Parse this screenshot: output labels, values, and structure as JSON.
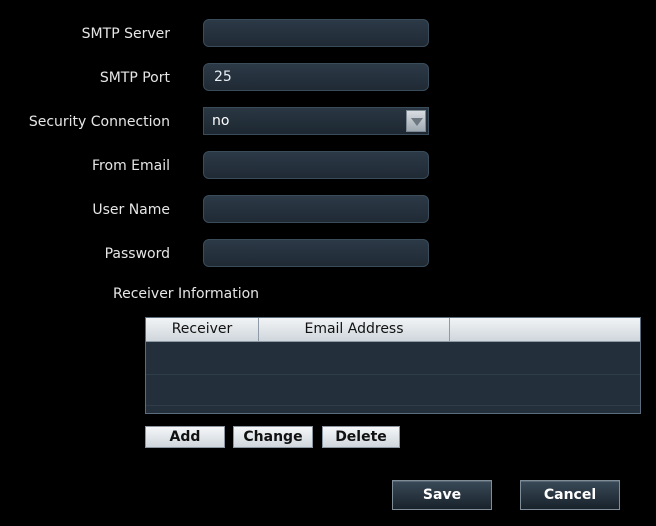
{
  "form": {
    "smtp_server": {
      "label": "SMTP Server",
      "value": ""
    },
    "smtp_port": {
      "label": "SMTP Port",
      "value": "25"
    },
    "security_connection": {
      "label": "Security Connection",
      "value": "no"
    },
    "from_email": {
      "label": "From Email",
      "value": ""
    },
    "user_name": {
      "label": "User Name",
      "value": ""
    },
    "password": {
      "label": "Password",
      "value": ""
    }
  },
  "receiver_info": {
    "title": "Receiver Information",
    "columns": [
      "Receiver",
      "Email Address",
      ""
    ]
  },
  "buttons": {
    "add": "Add",
    "change": "Change",
    "delete": "Delete",
    "save": "Save",
    "cancel": "Cancel"
  },
  "icons": {
    "select_arrow": "chevron-down-icon"
  },
  "colors": {
    "background": "#000000",
    "field_bg": "#243240",
    "field_border": "#3a4b5a",
    "table_bg": "#23303b"
  }
}
